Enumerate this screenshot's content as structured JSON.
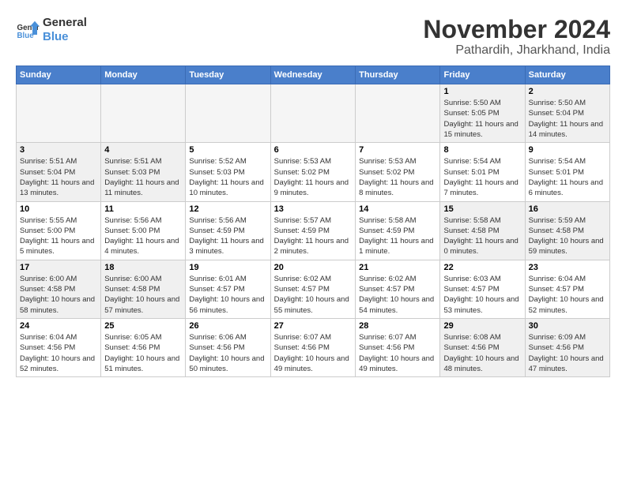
{
  "logo": {
    "line1": "General",
    "line2": "Blue"
  },
  "title": "November 2024",
  "subtitle": "Pathardih, Jharkhand, India",
  "weekdays": [
    "Sunday",
    "Monday",
    "Tuesday",
    "Wednesday",
    "Thursday",
    "Friday",
    "Saturday"
  ],
  "weeks": [
    [
      {
        "day": "",
        "info": "",
        "empty": true
      },
      {
        "day": "",
        "info": "",
        "empty": true
      },
      {
        "day": "",
        "info": "",
        "empty": true
      },
      {
        "day": "",
        "info": "",
        "empty": true
      },
      {
        "day": "",
        "info": "",
        "empty": true
      },
      {
        "day": "1",
        "info": "Sunrise: 5:50 AM\nSunset: 5:05 PM\nDaylight: 11 hours and 15 minutes."
      },
      {
        "day": "2",
        "info": "Sunrise: 5:50 AM\nSunset: 5:04 PM\nDaylight: 11 hours and 14 minutes."
      }
    ],
    [
      {
        "day": "3",
        "info": "Sunrise: 5:51 AM\nSunset: 5:04 PM\nDaylight: 11 hours and 13 minutes."
      },
      {
        "day": "4",
        "info": "Sunrise: 5:51 AM\nSunset: 5:03 PM\nDaylight: 11 hours and 11 minutes."
      },
      {
        "day": "5",
        "info": "Sunrise: 5:52 AM\nSunset: 5:03 PM\nDaylight: 11 hours and 10 minutes."
      },
      {
        "day": "6",
        "info": "Sunrise: 5:53 AM\nSunset: 5:02 PM\nDaylight: 11 hours and 9 minutes."
      },
      {
        "day": "7",
        "info": "Sunrise: 5:53 AM\nSunset: 5:02 PM\nDaylight: 11 hours and 8 minutes."
      },
      {
        "day": "8",
        "info": "Sunrise: 5:54 AM\nSunset: 5:01 PM\nDaylight: 11 hours and 7 minutes."
      },
      {
        "day": "9",
        "info": "Sunrise: 5:54 AM\nSunset: 5:01 PM\nDaylight: 11 hours and 6 minutes."
      }
    ],
    [
      {
        "day": "10",
        "info": "Sunrise: 5:55 AM\nSunset: 5:00 PM\nDaylight: 11 hours and 5 minutes."
      },
      {
        "day": "11",
        "info": "Sunrise: 5:56 AM\nSunset: 5:00 PM\nDaylight: 11 hours and 4 minutes."
      },
      {
        "day": "12",
        "info": "Sunrise: 5:56 AM\nSunset: 4:59 PM\nDaylight: 11 hours and 3 minutes."
      },
      {
        "day": "13",
        "info": "Sunrise: 5:57 AM\nSunset: 4:59 PM\nDaylight: 11 hours and 2 minutes."
      },
      {
        "day": "14",
        "info": "Sunrise: 5:58 AM\nSunset: 4:59 PM\nDaylight: 11 hours and 1 minute."
      },
      {
        "day": "15",
        "info": "Sunrise: 5:58 AM\nSunset: 4:58 PM\nDaylight: 11 hours and 0 minutes."
      },
      {
        "day": "16",
        "info": "Sunrise: 5:59 AM\nSunset: 4:58 PM\nDaylight: 10 hours and 59 minutes."
      }
    ],
    [
      {
        "day": "17",
        "info": "Sunrise: 6:00 AM\nSunset: 4:58 PM\nDaylight: 10 hours and 58 minutes."
      },
      {
        "day": "18",
        "info": "Sunrise: 6:00 AM\nSunset: 4:58 PM\nDaylight: 10 hours and 57 minutes."
      },
      {
        "day": "19",
        "info": "Sunrise: 6:01 AM\nSunset: 4:57 PM\nDaylight: 10 hours and 56 minutes."
      },
      {
        "day": "20",
        "info": "Sunrise: 6:02 AM\nSunset: 4:57 PM\nDaylight: 10 hours and 55 minutes."
      },
      {
        "day": "21",
        "info": "Sunrise: 6:02 AM\nSunset: 4:57 PM\nDaylight: 10 hours and 54 minutes."
      },
      {
        "day": "22",
        "info": "Sunrise: 6:03 AM\nSunset: 4:57 PM\nDaylight: 10 hours and 53 minutes."
      },
      {
        "day": "23",
        "info": "Sunrise: 6:04 AM\nSunset: 4:57 PM\nDaylight: 10 hours and 52 minutes."
      }
    ],
    [
      {
        "day": "24",
        "info": "Sunrise: 6:04 AM\nSunset: 4:56 PM\nDaylight: 10 hours and 52 minutes."
      },
      {
        "day": "25",
        "info": "Sunrise: 6:05 AM\nSunset: 4:56 PM\nDaylight: 10 hours and 51 minutes."
      },
      {
        "day": "26",
        "info": "Sunrise: 6:06 AM\nSunset: 4:56 PM\nDaylight: 10 hours and 50 minutes."
      },
      {
        "day": "27",
        "info": "Sunrise: 6:07 AM\nSunset: 4:56 PM\nDaylight: 10 hours and 49 minutes."
      },
      {
        "day": "28",
        "info": "Sunrise: 6:07 AM\nSunset: 4:56 PM\nDaylight: 10 hours and 49 minutes."
      },
      {
        "day": "29",
        "info": "Sunrise: 6:08 AM\nSunset: 4:56 PM\nDaylight: 10 hours and 48 minutes."
      },
      {
        "day": "30",
        "info": "Sunrise: 6:09 AM\nSunset: 4:56 PM\nDaylight: 10 hours and 47 minutes."
      }
    ]
  ]
}
